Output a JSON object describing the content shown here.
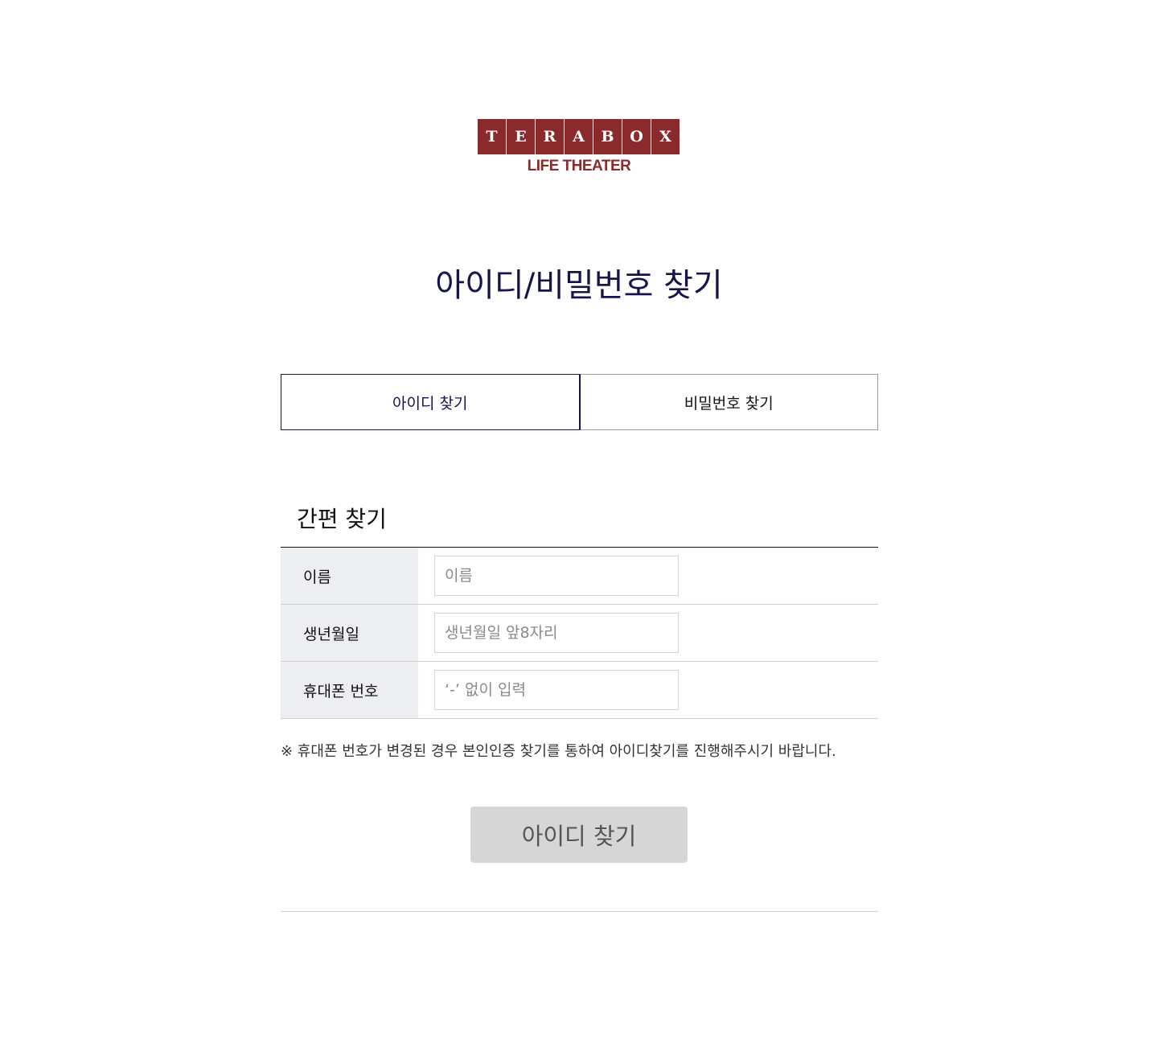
{
  "logo": {
    "letters": [
      "T",
      "E",
      "R",
      "A",
      "B",
      "O",
      "X"
    ],
    "subtitle": "LIFE THEATER",
    "brand_color": "#8b2a2c"
  },
  "page_title": "아이디/비밀번호 찾기",
  "tabs": [
    {
      "label": "아이디 찾기",
      "active": true
    },
    {
      "label": "비밀번호 찾기",
      "active": false
    }
  ],
  "section": {
    "title": "간편 찾기",
    "fields": [
      {
        "label": "이름",
        "placeholder": "이름",
        "value": ""
      },
      {
        "label": "생년월일",
        "placeholder": "생년월일 앞8자리",
        "value": ""
      },
      {
        "label": "휴대폰 번호",
        "placeholder": "‘-’ 없이 입력",
        "value": ""
      }
    ]
  },
  "notice": "※ 휴대폰 번호가 변경된 경우 본인인증 찾기를 통하여 아이디찾기를 진행해주시기 바랍니다.",
  "submit_label": "아이디 찾기",
  "colors": {
    "accent": "#15154a",
    "label_bg": "#eceef2",
    "button_bg": "#d6d6d6"
  }
}
